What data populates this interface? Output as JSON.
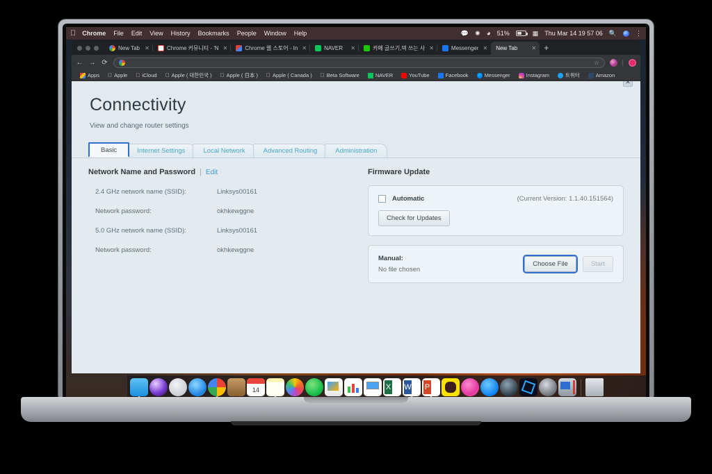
{
  "os": {
    "menubar": {
      "apple_glyph": "",
      "items": [
        {
          "label": "Chrome",
          "bold": true
        },
        {
          "label": "File",
          "bold": false
        },
        {
          "label": "Edit",
          "bold": false
        },
        {
          "label": "View",
          "bold": false
        },
        {
          "label": "History",
          "bold": false
        },
        {
          "label": "Bookmarks",
          "bold": false
        },
        {
          "label": "People",
          "bold": false
        },
        {
          "label": "Window",
          "bold": false
        },
        {
          "label": "Help",
          "bold": false
        }
      ],
      "status": {
        "battery_percent": "51%",
        "datetime": "Thu Mar 14  19 57 06",
        "icons": [
          "speech-bubble-icon",
          "bluetooth-icon",
          "wifi-icon",
          "battery-icon",
          "input-source-icon",
          "search-icon",
          "siri-icon",
          "control-center-icon"
        ]
      }
    },
    "dock": {
      "items": [
        {
          "name": "finder",
          "running": true
        },
        {
          "name": "siri",
          "running": false
        },
        {
          "name": "launchpad",
          "running": false
        },
        {
          "name": "safari",
          "running": false
        },
        {
          "name": "chrome",
          "running": true
        },
        {
          "name": "contacts",
          "running": false
        },
        {
          "name": "calendar",
          "running": false,
          "badge": "14"
        },
        {
          "name": "notes",
          "running": true
        },
        {
          "name": "photos",
          "running": false
        },
        {
          "name": "messages",
          "running": false
        },
        {
          "name": "keynote",
          "running": false
        },
        {
          "name": "numbers",
          "running": false
        },
        {
          "name": "keynote-presenter",
          "running": false
        },
        {
          "name": "excel",
          "running": false
        },
        {
          "name": "word",
          "running": true
        },
        {
          "name": "powerpoint",
          "running": true
        },
        {
          "name": "kakaotalk",
          "running": false
        },
        {
          "name": "itunes",
          "running": false
        },
        {
          "name": "app-store",
          "running": false
        },
        {
          "name": "steam",
          "running": false
        },
        {
          "name": "blue-app",
          "running": false
        },
        {
          "name": "system-preferences",
          "running": false
        },
        {
          "name": "remote-desktop",
          "running": false
        }
      ],
      "trash": "trash-icon"
    }
  },
  "browser": {
    "traffic_lights": [
      "close",
      "minimize",
      "zoom"
    ],
    "tabs": [
      {
        "label": "New Tab",
        "favicon": "google",
        "active": false,
        "closable": true
      },
      {
        "label": "Chrome 커뮤니티 - 'N",
        "favicon": "gmail",
        "active": false,
        "closable": true
      },
      {
        "label": "Chrome 웹 스토어 - In",
        "favicon": "webstore",
        "active": false,
        "closable": true
      },
      {
        "label": "NAVER",
        "favicon": "naver",
        "active": false,
        "closable": true
      },
      {
        "label": "카페 글쓰기,덱 쓰는 사",
        "favicon": "green",
        "active": false,
        "closable": true
      },
      {
        "label": "Messenger",
        "favicon": "facebook",
        "active": false,
        "closable": true
      },
      {
        "label": "New Tab",
        "favicon": "none",
        "active": true,
        "closable": true
      }
    ],
    "new_tab_label": "+",
    "toolbar": {
      "back": "←",
      "forward": "→",
      "reload": "⟳",
      "omnibox_value": "",
      "omnibox_placeholder": "",
      "star": "☆"
    },
    "bookmarks": [
      {
        "label": "Apps",
        "icon": "apps-grid"
      },
      {
        "label": "Apple",
        "icon": "apple"
      },
      {
        "label": "iCloud",
        "icon": "apple"
      },
      {
        "label": "Apple ( 대한민국 )",
        "icon": "apple"
      },
      {
        "label": "Apple ( 日本 )",
        "icon": "apple"
      },
      {
        "label": "Apple ( Canada )",
        "icon": "apple"
      },
      {
        "label": "Beta Software",
        "icon": "apple"
      },
      {
        "label": "NAVER",
        "icon": "naver"
      },
      {
        "label": "YouTube",
        "icon": "youtube"
      },
      {
        "label": "Facebook",
        "icon": "facebook"
      },
      {
        "label": "Messenger",
        "icon": "messenger"
      },
      {
        "label": "Instagram",
        "icon": "instagram"
      },
      {
        "label": "트위터",
        "icon": "twitter"
      },
      {
        "label": "Amazon",
        "icon": "amazon"
      }
    ]
  },
  "page": {
    "title": "Connectivity",
    "subtitle": "View and change router settings",
    "close_label": "✕",
    "tabs": [
      {
        "label": "Basic",
        "active": true
      },
      {
        "label": "Internet Settings",
        "active": false
      },
      {
        "label": "Local Network",
        "active": false
      },
      {
        "label": "Advanced Routing",
        "active": false
      },
      {
        "label": "Administration",
        "active": false
      }
    ],
    "network_section": {
      "heading": "Network Name and Password",
      "divider": "|",
      "edit_label": "Edit",
      "fields": [
        {
          "label": "2.4 GHz network name (SSID):",
          "value": "Linksys00161"
        },
        {
          "label": "Network password:",
          "value": "okhkewggne"
        },
        {
          "label": "5.0 GHz network name (SSID):",
          "value": "Linksys00161"
        },
        {
          "label": "Network password:",
          "value": "okhkewggne"
        }
      ]
    },
    "firmware_section": {
      "heading": "Firmware Update",
      "automatic_label": "Automatic",
      "automatic_checked": false,
      "current_version": "(Current Version: 1.1.40.151564)",
      "check_updates_label": "Check for Updates",
      "manual_label": "Manual:",
      "file_status": "No file chosen",
      "choose_file_label": "Choose File",
      "start_label": "Start",
      "start_disabled": true
    }
  },
  "colors": {
    "accent_blue": "#2f6fd0",
    "link_blue": "#3d9ad1",
    "tab_text": "#4aa8c8",
    "page_bg": "#e3eaf0"
  }
}
